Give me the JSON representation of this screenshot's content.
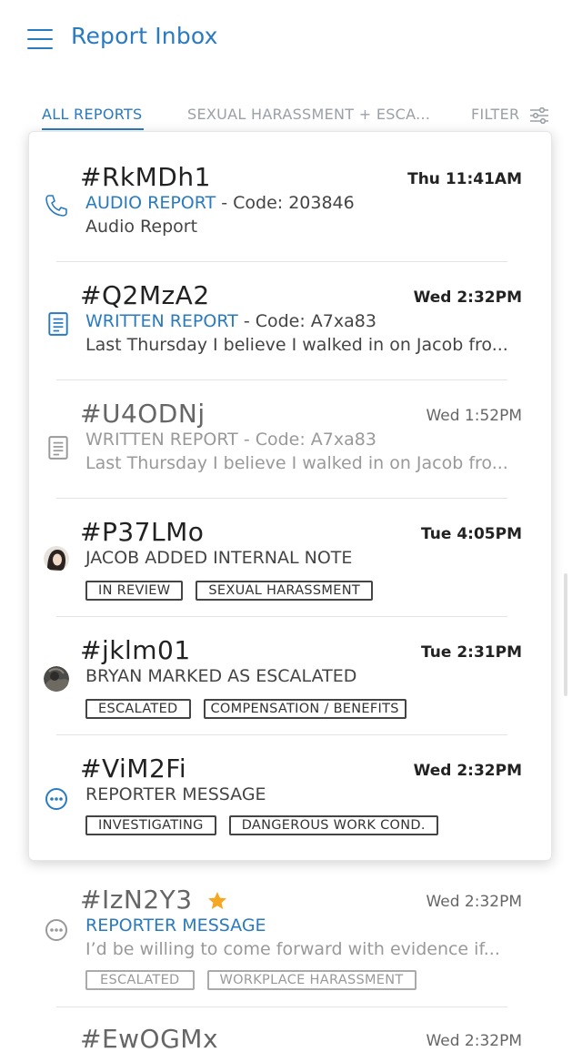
{
  "header": {
    "title": "Report Inbox"
  },
  "tabs": {
    "all": "ALL REPORTS",
    "category": "SEXUAL HARASSMENT + ESCA...",
    "filter": "FILTER"
  },
  "reports": [
    {
      "id": "#RkMDh1",
      "time": "Thu 11:41AM",
      "type": "AUDIO REPORT",
      "code": " - Code: 203846",
      "preview": "Audio Report",
      "icon": "phone-icon"
    },
    {
      "id": "#Q2MzA2",
      "time": "Wed 2:32PM",
      "type": "WRITTEN REPORT",
      "code": " - Code: A7xa83",
      "preview": "Last Thursday I believe I walked in on Jacob fro...",
      "icon": "document-icon"
    },
    {
      "id": "#U4ODNj",
      "time": "Wed 1:52PM",
      "type": "WRITTEN REPORT",
      "code": " - Code: A7xa83",
      "preview": "Last Thursday I believe I walked in on Jacob fro...",
      "icon": "document-icon"
    },
    {
      "id": "#P37LMo",
      "time": "Tue 4:05PM",
      "activity": "JACOB ADDED INTERNAL NOTE",
      "tags": [
        "IN REVIEW",
        "SEXUAL HARASSMENT"
      ],
      "icon": "avatar"
    },
    {
      "id": "#jklm01",
      "time": "Tue 2:31PM",
      "activity": "BRYAN MARKED AS ESCALATED",
      "tags": [
        "ESCALATED",
        "COMPENSATION / BENEFITS"
      ],
      "icon": "avatar"
    },
    {
      "id": "#ViM2Fi",
      "time": "Wed 2:32PM",
      "activity": "REPORTER MESSAGE",
      "tags": [
        "INVESTIGATING",
        "DANGEROUS WORK COND."
      ],
      "icon": "chat-icon"
    },
    {
      "id": "#IzN2Y3",
      "time": "Wed 2:32PM",
      "activity": "REPORTER MESSAGE",
      "preview": "I’d be willing to come forward with evidence if...",
      "tags": [
        "ESCALATED",
        "WORKPLACE HARASSMENT"
      ],
      "icon": "chat-icon",
      "starred": true
    },
    {
      "id": "#EwOGMx",
      "time": "Wed 2:32PM"
    }
  ],
  "colors": {
    "accent": "#2a7ac0",
    "activity": "#5cb85c",
    "star": "#f5a623"
  }
}
